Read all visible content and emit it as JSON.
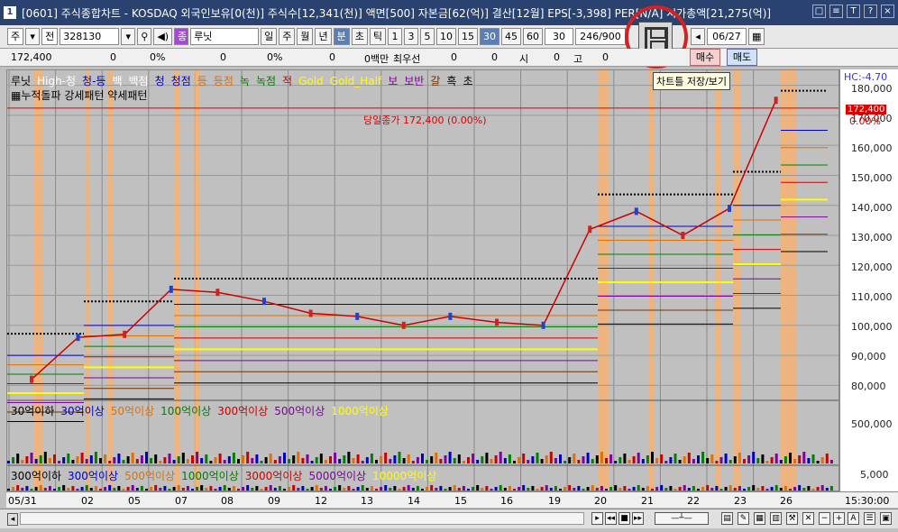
{
  "window": {
    "title": "[0601] 주식종합차트 - KOSDAQ 외국인보유[0(천)] 주식수[12,341(천)] 액면[500] 자본금[62(억)] 결산[12월] EPS[-3,398] PER[N/A] 시가총액[21,275(억)]",
    "app_icon": "1",
    "buttons": [
      "□",
      "≡",
      "T",
      "?",
      "×"
    ]
  },
  "toolbar": {
    "market": "주",
    "scope": "전",
    "code": "328130",
    "stock_icon": "종",
    "stock_name": "루닛",
    "periods": [
      "일",
      "주",
      "월",
      "년",
      "분",
      "초",
      "틱"
    ],
    "active_period": "분",
    "minutes": [
      "1",
      "3",
      "5",
      "10",
      "15",
      "30",
      "45",
      "60"
    ],
    "active_minute": "30",
    "interval_value": "30",
    "count": "246/900",
    "date": "06/27"
  },
  "infobar": {
    "price": "172,400",
    "change": "0",
    "change_pct": "0%",
    "volume": "0",
    "volume_pct": "0%",
    "trade_value": "0",
    "trade_pct": "0%",
    "unit": "0백만",
    "best_priority_label": "최우선",
    "bid": "0",
    "ask": "0",
    "open_label": "시",
    "open": "0",
    "high_label": "고",
    "high": "0"
  },
  "trade_buttons": {
    "buy": "매수",
    "sell": "매도"
  },
  "tooltip": "차트틀 저장/보기",
  "price_legend": {
    "items": [
      {
        "label": "루닛",
        "color": "#000000"
      },
      {
        "label": "High-청",
        "color": "#ffffff"
      },
      {
        "label": "청-등",
        "color": "#0000cc"
      },
      {
        "label": "백",
        "color": "#ffffff"
      },
      {
        "label": "백점",
        "color": "#ffffff"
      },
      {
        "label": "청",
        "color": "#0000cc"
      },
      {
        "label": "청점",
        "color": "#0000cc"
      },
      {
        "label": "등",
        "color": "#e07000"
      },
      {
        "label": "등점",
        "color": "#e07000"
      },
      {
        "label": "녹",
        "color": "#008000"
      },
      {
        "label": "녹점",
        "color": "#008000"
      },
      {
        "label": "적",
        "color": "#cc0000"
      },
      {
        "label": "Gold",
        "color": "#ffff00"
      },
      {
        "label": "Gold_Half",
        "color": "#ffff00"
      },
      {
        "label": "보",
        "color": "#8000a0"
      },
      {
        "label": "보반",
        "color": "#8000a0"
      },
      {
        "label": "갈",
        "color": "#703000"
      },
      {
        "label": "흑",
        "color": "#000000"
      },
      {
        "label": "초",
        "color": "#000000"
      }
    ],
    "pattern_line": "누적돌파 강세패턴 약세패턴",
    "current_price_note": "당일종가 172,400 (0.00%)"
  },
  "volume_legend": {
    "items": [
      {
        "label": "30억이하",
        "color": "#000000"
      },
      {
        "label": "30억이상",
        "color": "#0000cc"
      },
      {
        "label": "50억이상",
        "color": "#e07000"
      },
      {
        "label": "100억이상",
        "color": "#008000"
      },
      {
        "label": "300억이상",
        "color": "#cc0000"
      },
      {
        "label": "500억이상",
        "color": "#8000a0"
      },
      {
        "label": "1000억이상",
        "color": "#ffff00"
      }
    ]
  },
  "value_legend": {
    "items": [
      {
        "label": "300억이하",
        "color": "#000000"
      },
      {
        "label": "300억이상",
        "color": "#0000cc"
      },
      {
        "label": "500억이상",
        "color": "#e07000"
      },
      {
        "label": "1000억이상",
        "color": "#008000"
      },
      {
        "label": "3000억이상",
        "color": "#cc0000"
      },
      {
        "label": "5000억이상",
        "color": "#8000a0"
      },
      {
        "label": "10000억이상",
        "color": "#ffff00"
      }
    ]
  },
  "right_axis": {
    "hc_label": "HC:-4.70",
    "price_ticks": [
      "180,000",
      "170,000",
      "160,000",
      "150,000",
      "140,000",
      "130,000",
      "120,000",
      "110,000",
      "100,000",
      "90,000",
      "80,000"
    ],
    "current_price": "172,400",
    "current_pct": "0.00%",
    "volume_tick": "500,000",
    "value_tick": "5,000"
  },
  "x_axis": {
    "labels": [
      "05/31",
      "02",
      "05",
      "07",
      "08",
      "09",
      "12",
      "13",
      "14",
      "15",
      "16",
      "19",
      "20",
      "21",
      "22",
      "23",
      "26"
    ],
    "time": "15:30:00"
  },
  "chart_data": {
    "type": "line",
    "x": [
      "05/31",
      "06/02",
      "06/05",
      "06/07",
      "06/08",
      "06/09",
      "06/12",
      "06/13",
      "06/14",
      "06/15",
      "06/16",
      "06/19",
      "06/20",
      "06/21",
      "06/22",
      "06/23",
      "06/26"
    ],
    "series": [
      {
        "name": "루닛",
        "values": [
          82000,
          96000,
          97000,
          112000,
          111000,
          108000,
          104000,
          103000,
          100000,
          103000,
          101000,
          100000,
          132000,
          138000,
          130000,
          139000,
          175000
        ]
      }
    ],
    "ylim": [
      75000,
      185000
    ]
  }
}
